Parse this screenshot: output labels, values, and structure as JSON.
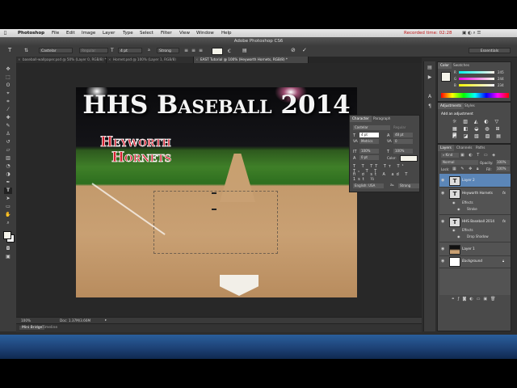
{
  "menubar": {
    "apple": "",
    "app_name": "Photoshop",
    "items": [
      "File",
      "Edit",
      "Image",
      "Layer",
      "Type",
      "Select",
      "Filter",
      "View",
      "Window",
      "Help"
    ],
    "recorded_time": "Recorded time: 02:28"
  },
  "window_title": "Adobe Photoshop CS6",
  "options_bar": {
    "font_family": "Castelar",
    "font_style": "Regular",
    "font_size": "4 pt",
    "aa_label": "a",
    "antialias": "Strong",
    "workspace": "Essentials"
  },
  "doc_tabs": [
    {
      "label": "baseball-wallpaper.psd @ 50% (Layer 0, RGB/8) *",
      "active": false
    },
    {
      "label": "Hornet.psd @ 100% (Layer 1, RGB/8)",
      "active": false
    },
    {
      "label": "EAST Tutorial @ 100% (Heyworth Hornets, RGB/8) *",
      "active": true
    }
  ],
  "canvas": {
    "headline": "HHS Baseball 2014",
    "subtitle_line1": "Heyworth",
    "subtitle_line2": "Hornets",
    "colors": {
      "headline": "#f4f4f4",
      "subtitle": "#d42030",
      "subtitle_stroke": "#ffffff"
    }
  },
  "status": {
    "zoom": "100%",
    "doc_size": "Doc: 1.37M/3.66M"
  },
  "bottom_tabs": [
    "Mini Bridge",
    "Timeline"
  ],
  "character_panel": {
    "tabs": [
      "Character",
      "Paragraph"
    ],
    "font_family": "Castelar",
    "font_style": "Regular",
    "font_size": "4 pt",
    "leading": "48 pt",
    "kerning": "Metrics",
    "tracking": "0",
    "v_scale": "100%",
    "h_scale": "100%",
    "baseline": "0 pt",
    "color_label": "Color:",
    "language": "English: USA",
    "aa_label": "aₐ",
    "antialias": "Strong"
  },
  "color_panel": {
    "tabs": [
      "Color",
      "Swatches"
    ],
    "r_label": "R",
    "r_value": "245",
    "g_label": "G",
    "g_value": "244",
    "b_label": "B",
    "b_value": "234"
  },
  "adjustments_panel": {
    "tabs": [
      "Adjustments",
      "Styles"
    ],
    "heading": "Add an adjustment"
  },
  "layers_panel": {
    "tabs": [
      "Layers",
      "Channels",
      "Paths"
    ],
    "kind": "Kind",
    "blend_mode": "Normal",
    "opacity_label": "Opacity:",
    "opacity": "100%",
    "lock_label": "Lock:",
    "fill_label": "Fill:",
    "fill": "100%",
    "layers": [
      {
        "name": "Layer 2",
        "type": "text",
        "selected": true
      },
      {
        "name": "Heyworth Hornets",
        "type": "text",
        "selected": false,
        "fx": true,
        "effects_label": "Effects",
        "effects": [
          "Stroke"
        ]
      },
      {
        "name": "HHS Baseball 2014",
        "type": "text",
        "selected": false,
        "fx": true,
        "effects_label": "Effects",
        "effects": [
          "Drop Shadow"
        ]
      },
      {
        "name": "Layer 1",
        "type": "image",
        "selected": false
      },
      {
        "name": "Background",
        "type": "background",
        "selected": false
      }
    ]
  }
}
